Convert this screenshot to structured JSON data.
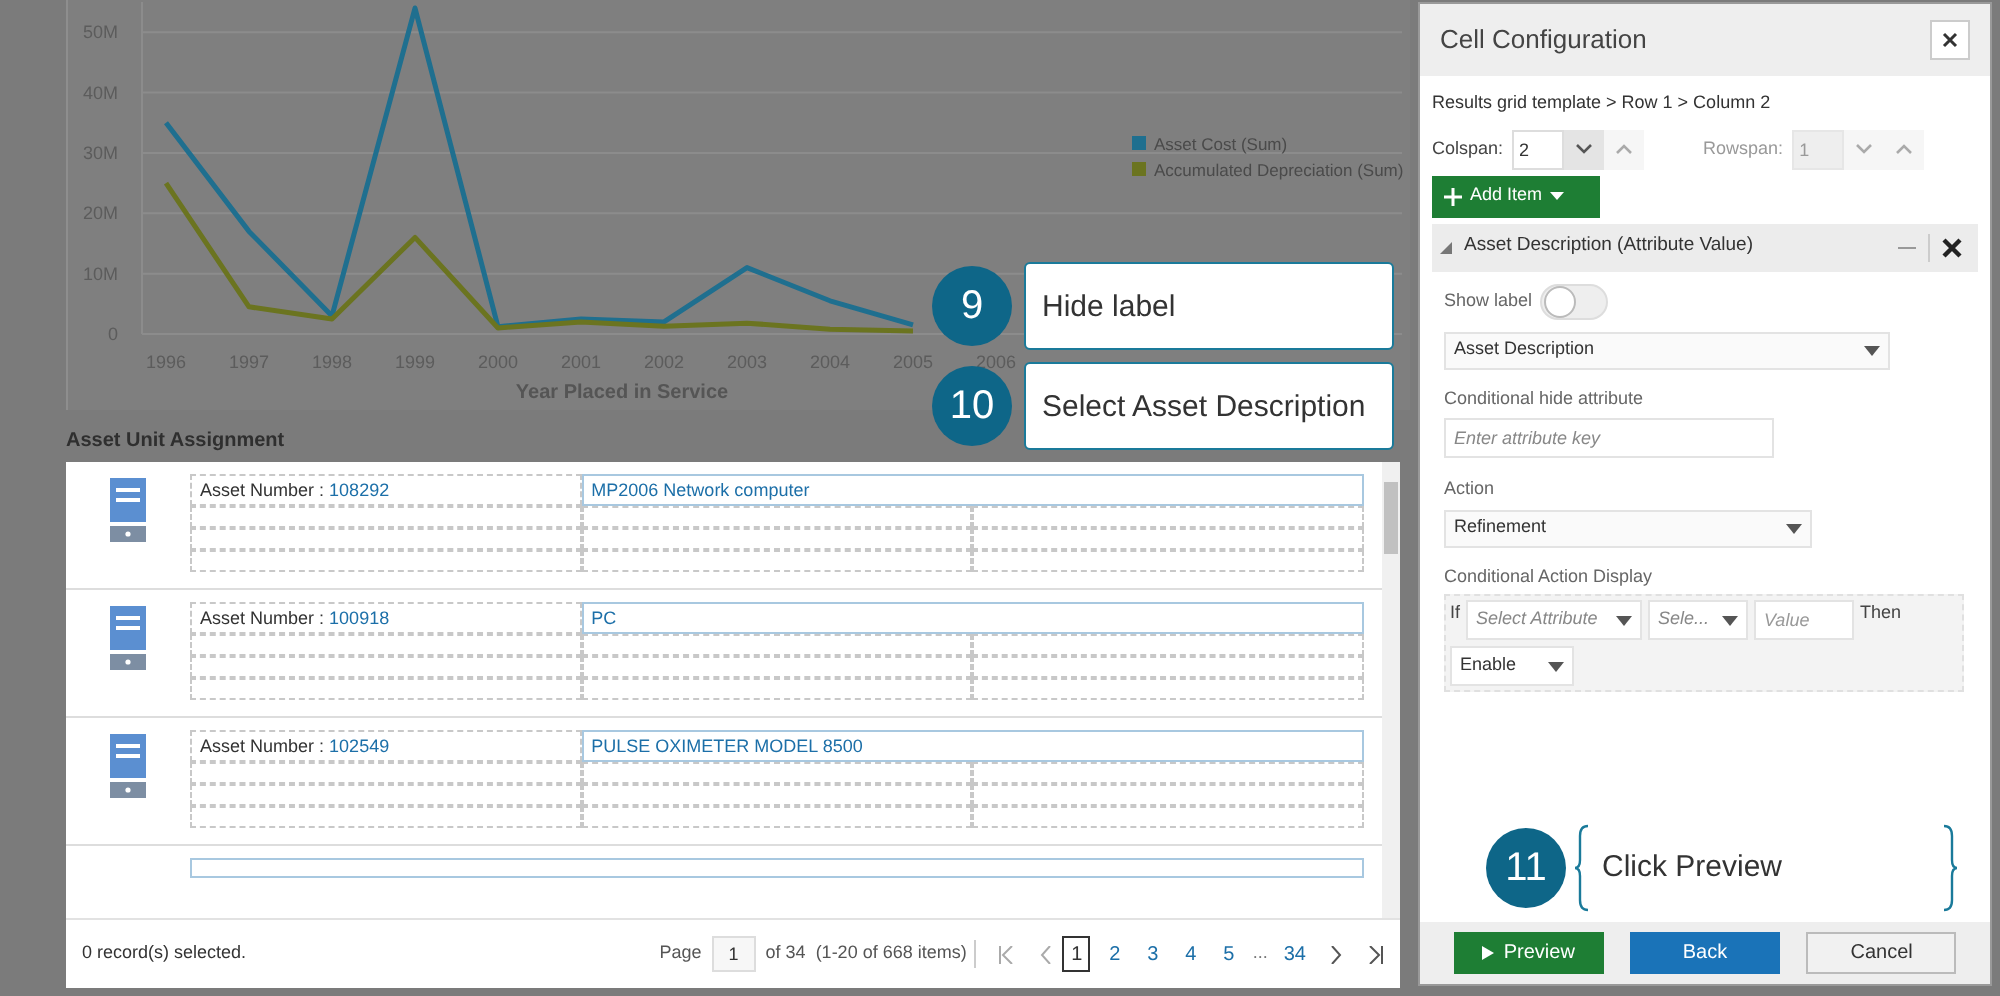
{
  "chart": {
    "chart_data": {
      "type": "line",
      "xlabel": "Year Placed in Service",
      "ylim": [
        0,
        55
      ],
      "grid": true,
      "legend": true,
      "categories": [
        "1996",
        "1997",
        "1998",
        "1999",
        "2000",
        "2001",
        "2002",
        "2003",
        "2004",
        "2005",
        "2006"
      ],
      "series": [
        {
          "name": "Asset Cost (Sum)",
          "color": "#1f6f8f",
          "values": [
            35,
            17,
            3,
            54,
            1.2,
            2.5,
            2,
            11,
            5.5,
            1.5,
            null
          ]
        },
        {
          "name": "Accumulated Depreciation (Sum)",
          "color": "#6b7420",
          "values": [
            25,
            4.5,
            2.5,
            16,
            1,
            2,
            1.3,
            1.8,
            0.8,
            0.5,
            null
          ]
        }
      ],
      "yticks": [
        {
          "value": 0,
          "label": "0"
        },
        {
          "value": 10,
          "label": "10M"
        },
        {
          "value": 20,
          "label": "20M"
        },
        {
          "value": 30,
          "label": "30M"
        },
        {
          "value": 40,
          "label": "40M"
        },
        {
          "value": 50,
          "label": "50M"
        }
      ]
    }
  },
  "section_title": "Asset Unit Assignment",
  "assets": [
    {
      "label": "Asset Number :",
      "number": "108292",
      "description": "MP2006 Network computer"
    },
    {
      "label": "Asset Number :",
      "number": "100918",
      "description": "PC"
    },
    {
      "label": "Asset Number :",
      "number": "102549",
      "description": "PULSE OXIMETER MODEL 8500"
    }
  ],
  "selection_status": "0 record(s) selected.",
  "pagination": {
    "page_label": "Page",
    "page_value": "1",
    "of_total": "of 34",
    "range": "(1-20 of 668 items)",
    "pages": [
      {
        "label": "1",
        "kind": "page",
        "selected": true
      },
      {
        "label": "2",
        "kind": "page",
        "selected": false
      },
      {
        "label": "3",
        "kind": "page",
        "selected": false
      },
      {
        "label": "4",
        "kind": "page",
        "selected": false
      },
      {
        "label": "5",
        "kind": "page",
        "selected": false
      },
      {
        "label": "...",
        "kind": "ellipsis"
      },
      {
        "label": "34",
        "kind": "page",
        "selected": false
      }
    ]
  },
  "panel": {
    "title": "Cell Configuration",
    "breadcrumb": "Results grid template > Row 1 > Column 2",
    "spans": [
      {
        "label": "Colspan:",
        "value": "2",
        "disabled": false
      },
      {
        "label": "Rowspan:",
        "value": "1",
        "disabled": true
      }
    ],
    "add_button": "Add Item",
    "item": {
      "title": "Asset Description (Attribute Value)",
      "expanded": true
    },
    "show_label": {
      "label": "Show label",
      "on": false
    },
    "attribute_select": "Asset Description",
    "hide_attribute": {
      "label": "Conditional hide attribute",
      "placeholder": "Enter attribute key"
    },
    "action": {
      "label": "Action",
      "value": "Refinement"
    },
    "conditional": {
      "label": "Conditional Action Display",
      "if": "If",
      "attribute_placeholder": "Select Attribute",
      "operator_placeholder": "Sele...",
      "value_placeholder": "Value",
      "then": "Then",
      "result": "Enable"
    },
    "buttons": [
      {
        "label": "Preview",
        "kind": "primary"
      },
      {
        "label": "Back",
        "kind": "secondary"
      },
      {
        "label": "Cancel",
        "kind": "default"
      }
    ]
  },
  "callouts": [
    {
      "number": "9",
      "text": "Hide label",
      "kind": "box"
    },
    {
      "number": "10",
      "text": "Select Asset Description",
      "kind": "box"
    },
    {
      "number": "11",
      "text": "Click Preview",
      "kind": "brace"
    }
  ]
}
